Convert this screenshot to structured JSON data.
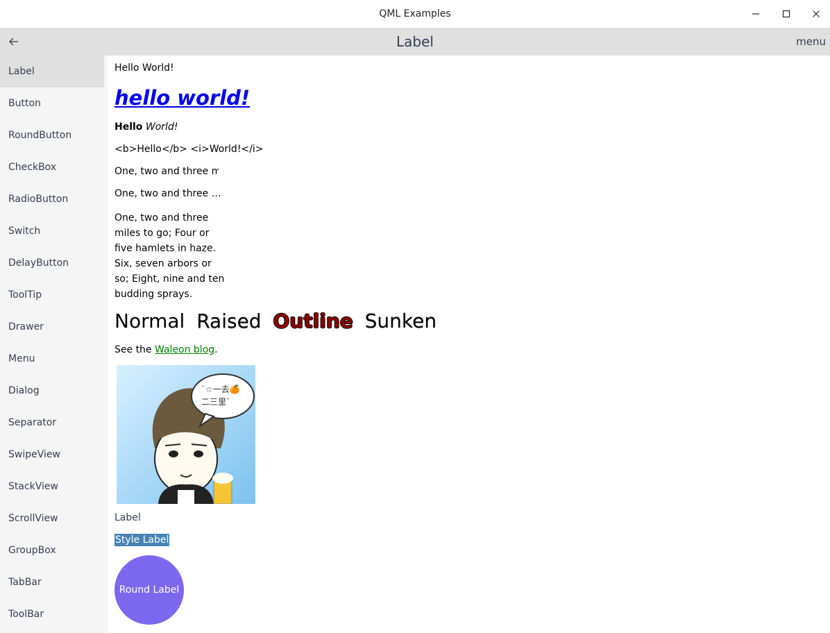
{
  "window": {
    "title": "QML Examples"
  },
  "header": {
    "title": "Label",
    "menu_label": "menu"
  },
  "sidebar": {
    "items": [
      {
        "label": "Label"
      },
      {
        "label": "Button"
      },
      {
        "label": "RoundButton"
      },
      {
        "label": "CheckBox"
      },
      {
        "label": "RadioButton"
      },
      {
        "label": "Switch"
      },
      {
        "label": "DelayButton"
      },
      {
        "label": "ToolTip"
      },
      {
        "label": "Drawer"
      },
      {
        "label": "Menu"
      },
      {
        "label": "Dialog"
      },
      {
        "label": "Separator"
      },
      {
        "label": "SwipeView"
      },
      {
        "label": "StackView"
      },
      {
        "label": "ScrollView"
      },
      {
        "label": "GroupBox"
      },
      {
        "label": "TabBar"
      },
      {
        "label": "ToolBar"
      }
    ],
    "active_index": 0
  },
  "content": {
    "hello_world": "Hello World!",
    "big_link": "hello world!",
    "rich_bold": "Hello",
    "rich_italic": "World!",
    "plain_markup": "<b>Hello</b> <i>World!</i>",
    "clipped_text": "One, two and three miles to go",
    "elided_text": "One, two and three …",
    "wrapped_text": "One, two and three miles to go; Four or five hamlets in haze. Six, seven arbors or so; Eight, nine and ten budding sprays.",
    "style_normal": "Normal",
    "style_raised": "Raised",
    "style_outline": "Outline",
    "style_sunken": "Sunken",
    "blog_prefix": "See the ",
    "blog_link": "Waleon blog",
    "blog_suffix": ".",
    "avatar_bubble_line1": "`☆一去🍊",
    "avatar_bubble_line2": "二三里`",
    "label": "Label",
    "style_label": "Style Label",
    "round_label": "Round Label"
  },
  "colors": {
    "header_bg": "#e0e0e0",
    "sidebar_bg": "#f5f5f5",
    "link_blue": "#0000ee",
    "link_green": "#008000",
    "outline_red": "#8b0000",
    "style_label_bg": "#4682b4",
    "round_label_bg": "#7b68ee"
  }
}
